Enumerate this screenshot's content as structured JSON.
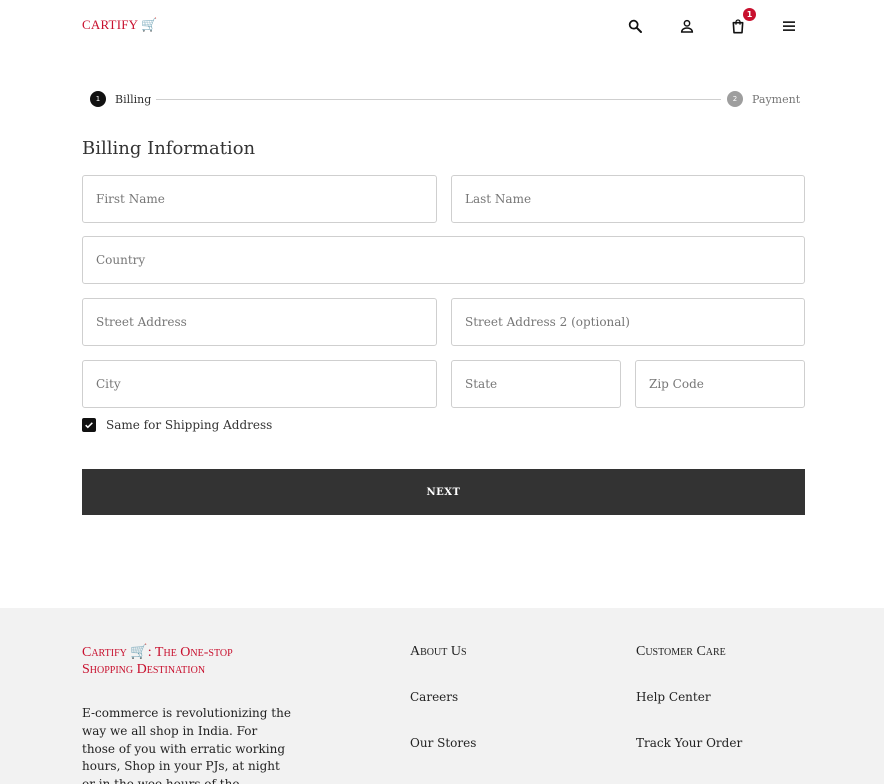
{
  "header": {
    "logo": "CARTIFY 🛒",
    "cart_count": "1",
    "icons": [
      "search-icon",
      "user-icon",
      "shopping-bag-icon",
      "menu-icon"
    ]
  },
  "stepper": {
    "steps": [
      {
        "number": "1",
        "label": "Billing",
        "state": "active"
      },
      {
        "number": "2",
        "label": "Payment",
        "state": "inactive"
      }
    ]
  },
  "form": {
    "title": "Billing Information",
    "first_name": {
      "placeholder": "First Name",
      "value": ""
    },
    "last_name": {
      "placeholder": "Last Name",
      "value": ""
    },
    "country": {
      "placeholder": "Country",
      "value": ""
    },
    "street_address": {
      "placeholder": "Street Address",
      "value": ""
    },
    "street_address_2": {
      "placeholder": "Street Address 2 (optional)",
      "value": ""
    },
    "city": {
      "placeholder": "City",
      "value": ""
    },
    "state": {
      "placeholder": "State",
      "value": ""
    },
    "zip": {
      "placeholder": "Zip Code",
      "value": ""
    },
    "same_shipping_label": "Same for Shipping Address",
    "same_shipping_checked": true,
    "next_label": "NEXT"
  },
  "footer": {
    "brand": "Cartify 🛒: The One-stop Shopping Destination",
    "description": "E-commerce is revolutionizing the way we all shop in India. For those of you with erratic working hours, Shop in your PJs, at night or in the wee hours of the morning. This E-",
    "about_heading": "About Us",
    "about_links": [
      "Careers",
      "Our Stores"
    ],
    "care_heading": "Customer Care",
    "care_links": [
      "Help Center",
      "Track Your Order"
    ]
  },
  "colors": {
    "brand_red": "#c8102e",
    "button_dark": "#333333",
    "footer_bg": "#f2f2f2"
  }
}
